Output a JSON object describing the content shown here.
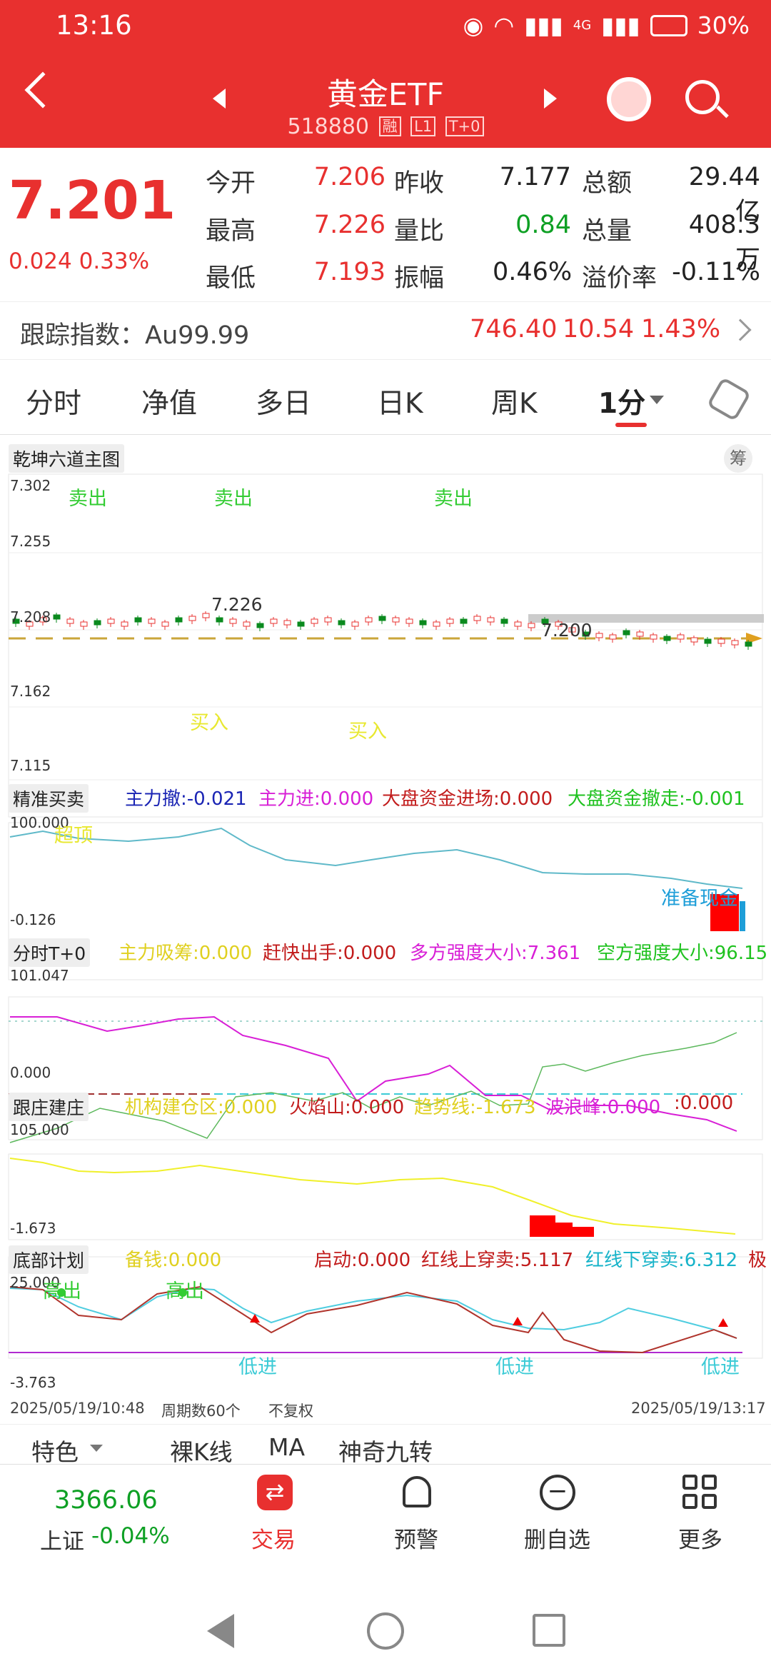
{
  "status": {
    "time": "13:16",
    "battery": "30%",
    "network": "4G"
  },
  "header": {
    "title": "黄金ETF",
    "code": "518880",
    "tags": [
      "融",
      "L1",
      "T+0"
    ]
  },
  "quote": {
    "price": "7.201",
    "change": "0.024",
    "change_pct": "0.33%",
    "rows": [
      {
        "l1": "今开",
        "v1": "7.206",
        "l2": "昨收",
        "v2": "7.177",
        "l3": "总额",
        "v3": "29.44亿"
      },
      {
        "l1": "最高",
        "v1": "7.226",
        "l2": "量比",
        "v2": "0.84",
        "l3": "总量",
        "v3": "408.3万"
      },
      {
        "l1": "最低",
        "v1": "7.193",
        "l2": "振幅",
        "v2": "0.46%",
        "l3": "溢价率",
        "v3": "-0.11%"
      }
    ]
  },
  "tracking": {
    "label": "跟踪指数：Au99.99",
    "value": "746.40",
    "change": "10.54",
    "pct": "1.43%"
  },
  "tabs": [
    "分时",
    "净值",
    "多日",
    "日K",
    "周K",
    "1分"
  ],
  "colors": {
    "accent": "#e8302f",
    "up": "#e8302f",
    "down": "#0ea024"
  },
  "main_chart": {
    "name": "乾坤六道主图",
    "chip_button": "筹",
    "y_ticks": [
      "7.302",
      "7.255",
      "7.208",
      "7.162",
      "7.115"
    ],
    "signals": {
      "sell": "卖出",
      "buy": "买入"
    },
    "high_label": "7.226",
    "last_label": "7.200"
  },
  "panel2": {
    "name": "精准买卖",
    "ind1": "主力撤:-0.021",
    "ind2": "主力进:0.000",
    "ind3": "大盘资金进场:0.000",
    "ind4": "大盘资金撤走:-0.001",
    "top": "100.000",
    "bottom": "-0.126",
    "note1": "超顶",
    "note2": "准备现金"
  },
  "panel3": {
    "name": "分时T+0",
    "ind1": "主力吸筹:0.000",
    "ind2": "赶快出手:0.000",
    "ind3": "多方强度大小:7.361",
    "ind4": "空方强度大小:96.15",
    "top": "101.047",
    "bottom": "0.000"
  },
  "panel4": {
    "name": "跟庄建庄",
    "ind1": "机构建仓区:0.000",
    "ind2": "火焰山:0.000",
    "ind3": "趋势线:-1.673",
    "ind4": "波浪峰:0.000",
    "ind5": ":0.000",
    "top": "105.000",
    "bottom": "-1.673"
  },
  "panel5": {
    "name": "底部计划",
    "ind1": "备钱:0.000",
    "ind2": "启动:0.000",
    "ind3": "红线上穿卖:5.117",
    "ind4": "红线下穿卖:6.312",
    "ind5": "极",
    "top": "25.000",
    "bottom": "-3.763",
    "high": "高出",
    "low": "低进"
  },
  "footer_info": {
    "start": "2025/05/19/10:48",
    "period": "周期数60个",
    "adjust": "不复权",
    "end": "2025/05/19/13:17"
  },
  "feature_bar": {
    "special": "特色",
    "items": [
      "裸K线",
      "MA",
      "神奇九转"
    ]
  },
  "bottom": {
    "index_value": "3366.06",
    "index_name": "上证",
    "index_change": "-0.04%",
    "items": [
      "交易",
      "预警",
      "删自选",
      "更多"
    ]
  }
}
